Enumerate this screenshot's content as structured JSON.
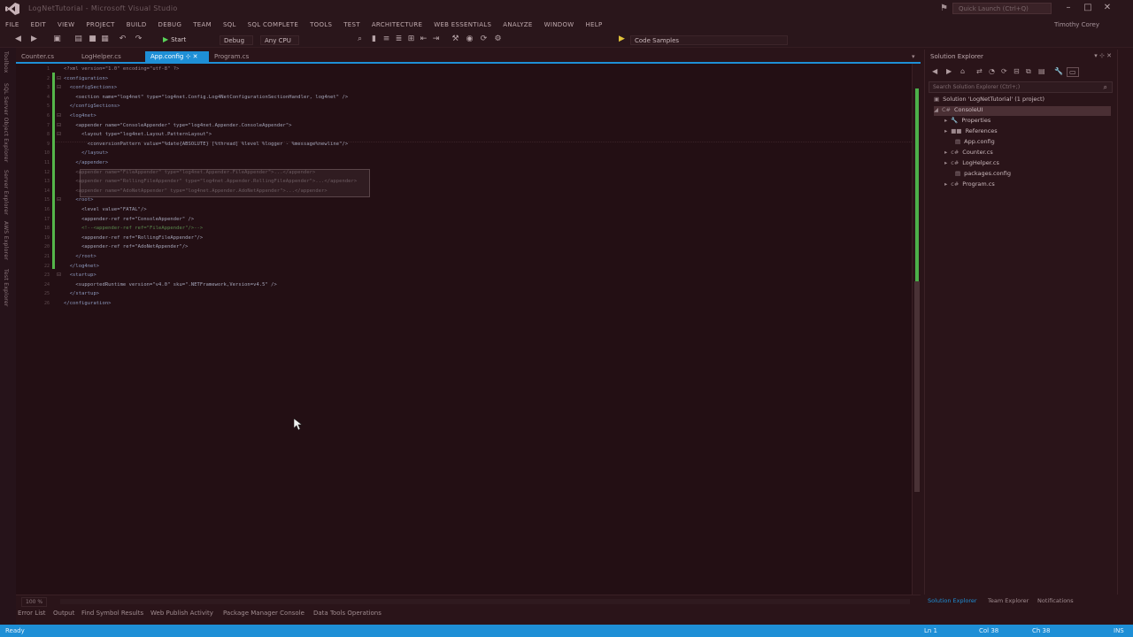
{
  "window": {
    "title": "LogNetTutorial - Microsoft Visual Studio",
    "quick_launch_placeholder": "Quick Launch (Ctrl+Q)",
    "user": "Timothy Corey"
  },
  "menu": [
    "FILE",
    "EDIT",
    "VIEW",
    "PROJECT",
    "BUILD",
    "DEBUG",
    "TEAM",
    "SQL",
    "SQL COMPLETE",
    "TOOLS",
    "TEST",
    "ARCHITECTURE",
    "WEB ESSENTIALS",
    "ANALYZE",
    "WINDOW",
    "HELP"
  ],
  "toolbar": {
    "start_label": "Start",
    "config": "Debug",
    "platform": "Any CPU",
    "code_samples": "Code Samples"
  },
  "left_tool_tabs": [
    "Toolbox",
    "SQL Server Object Explorer",
    "Server Explorer",
    "AWS Explorer",
    "Test Explorer"
  ],
  "doc_tabs": [
    {
      "label": "Counter.cs",
      "active": false
    },
    {
      "label": "LogHelper.cs",
      "active": false
    },
    {
      "label": "App.config",
      "active": true
    },
    {
      "label": "Program.cs",
      "active": false
    }
  ],
  "editor": {
    "lines": [
      {
        "n": "1",
        "text": "<?xml version=\"1.0\" encoding=\"utf-8\" ?>",
        "color": "#9b8690"
      },
      {
        "n": "2",
        "text": "<configuration>",
        "color": "#8e9bc0"
      },
      {
        "n": "3",
        "text": "  <configSections>",
        "color": "#8e9bc0"
      },
      {
        "n": "4",
        "text": "    <section name=\"log4net\" type=\"log4net.Config.Log4NetConfigurationSectionHandler, log4net\" />",
        "color": "#a6a7bb"
      },
      {
        "n": "5",
        "text": "  </configSections>",
        "color": "#8e9bc0"
      },
      {
        "n": "6",
        "text": "  <log4net>",
        "color": "#8e9bc0"
      },
      {
        "n": "7",
        "text": "    <appender name=\"ConsoleAppender\" type=\"log4net.Appender.ConsoleAppender\">",
        "color": "#a6a7bb"
      },
      {
        "n": "8",
        "text": "      <layout type=\"log4net.Layout.PatternLayout\">",
        "color": "#a6a7bb"
      },
      {
        "n": "9",
        "text": "        <conversionPattern value=\"%date{ABSOLUTE} [%thread] %level %logger - %message%newline\"/>",
        "color": "#a6a7bb"
      },
      {
        "n": "10",
        "text": "      </layout>",
        "color": "#8e9bc0"
      },
      {
        "n": "11",
        "text": "    </appender>",
        "color": "#8e9bc0"
      },
      {
        "n": "12",
        "text": "    <appender name=\"FileAppender\" type=\"log4net.Appender.FileAppender\">...</appender>",
        "color": "#6d5c62"
      },
      {
        "n": "13",
        "text": "    <appender name=\"RollingFileAppender\" type=\"log4net.Appender.RollingFileAppender\">...</appender>",
        "color": "#6d5c62"
      },
      {
        "n": "14",
        "text": "    <appender name=\"AdoNetAppender\" type=\"log4net.Appender.AdoNetAppender\">...</appender>",
        "color": "#6d5c62"
      },
      {
        "n": "15",
        "text": "    <root>",
        "color": "#8e9bc0"
      },
      {
        "n": "16",
        "text": "      <level value=\"FATAL\"/>",
        "color": "#a6a7bb"
      },
      {
        "n": "17",
        "text": "      <appender-ref ref=\"ConsoleAppender\" />",
        "color": "#a6a7bb"
      },
      {
        "n": "18",
        "text": "      <!--<appender-ref ref=\"FileAppender\"/>-->",
        "color": "#5a8a4e"
      },
      {
        "n": "19",
        "text": "      <appender-ref ref=\"RollingFileAppender\"/>",
        "color": "#a6a7bb"
      },
      {
        "n": "20",
        "text": "      <appender-ref ref=\"AdoNetAppender\"/>",
        "color": "#a6a7bb"
      },
      {
        "n": "21",
        "text": "    </root>",
        "color": "#8e9bc0"
      },
      {
        "n": "22",
        "text": "  </log4net>",
        "color": "#8e9bc0"
      },
      {
        "n": "23",
        "text": "  <startup>",
        "color": "#8e9bc0"
      },
      {
        "n": "24",
        "text": "    <supportedRuntime version=\"v4.0\" sku=\".NETFramework,Version=v4.5\" />",
        "color": "#a6a7bb"
      },
      {
        "n": "25",
        "text": "  </startup>",
        "color": "#8e9bc0"
      },
      {
        "n": "26",
        "text": "</configuration>",
        "color": "#8e9bc0"
      }
    ],
    "zoom": "100 %"
  },
  "bottom_tabs": [
    "Error List",
    "Output",
    "Find Symbol Results",
    "Web Publish Activity",
    "Package Manager Console",
    "Data Tools Operations"
  ],
  "status": {
    "left": "Ready",
    "line": "Ln 1",
    "col": "Col 38",
    "ch": "Ch 38",
    "mode": "INS"
  },
  "solution_explorer": {
    "title": "Solution Explorer",
    "search_placeholder": "Search Solution Explorer (Ctrl+;)",
    "items": [
      {
        "label": "Solution 'LogNetTutorial' (1 project)",
        "icon": "solution-icon"
      },
      {
        "label": "ConsoleUI",
        "icon": "project-icon"
      },
      {
        "label": "Properties",
        "icon": "wrench-icon"
      },
      {
        "label": "References",
        "icon": "references-icon"
      },
      {
        "label": "App.config",
        "icon": "config-icon"
      },
      {
        "label": "Counter.cs",
        "icon": "csharp-icon"
      },
      {
        "label": "LogHelper.cs",
        "icon": "csharp-icon"
      },
      {
        "label": "packages.config",
        "icon": "config-icon"
      },
      {
        "label": "Program.cs",
        "icon": "csharp-icon"
      }
    ],
    "bottom_tabs": [
      "Solution Explorer",
      "Team Explorer",
      "Notifications"
    ]
  },
  "colors": {
    "accent": "#1e8fd6",
    "background": "#230f14",
    "change_bar": "#55b64a"
  }
}
